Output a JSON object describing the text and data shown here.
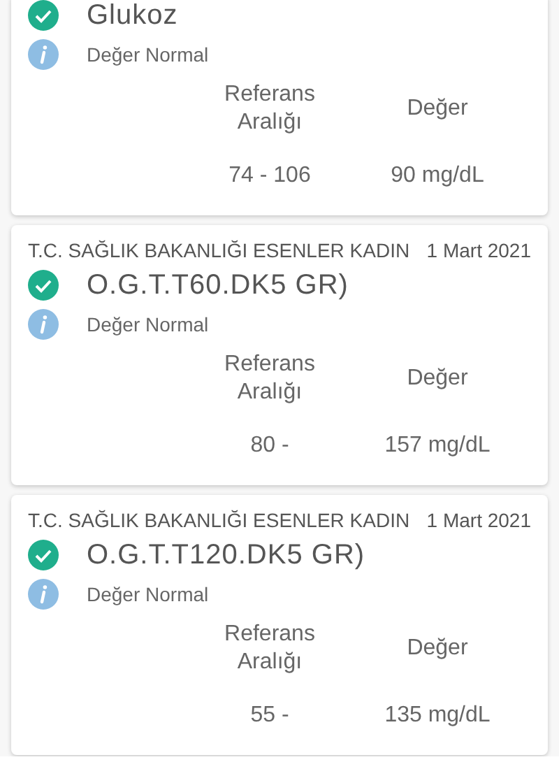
{
  "results": [
    {
      "test": "Glukoz",
      "normal": true,
      "note": "Değer Normal",
      "range_label": "Referans Aralığı",
      "value_label": "Değer",
      "range": "74 - 106",
      "value": "90 mg/dL"
    },
    {
      "source": "T.C. SAĞLIK BAKANLIĞI ESENLER KADIN",
      "date": "1 Mart 2021",
      "test": "O.G.T.T60.DK5 GR)",
      "normal": true,
      "note": "Değer Normal",
      "range_label": "Referans Aralığı",
      "value_label": "Değer",
      "range": "80 -",
      "value": "157 mg/dL"
    },
    {
      "source": "T.C. SAĞLIK BAKANLIĞI ESENLER KADIN",
      "date": "1 Mart 2021",
      "test": "O.G.T.T120.DK5 GR)",
      "normal": true,
      "note": "Değer Normal",
      "range_label": "Referans Aralığı",
      "value_label": "Değer",
      "range": "55 -",
      "value": "135 mg/dL"
    }
  ]
}
